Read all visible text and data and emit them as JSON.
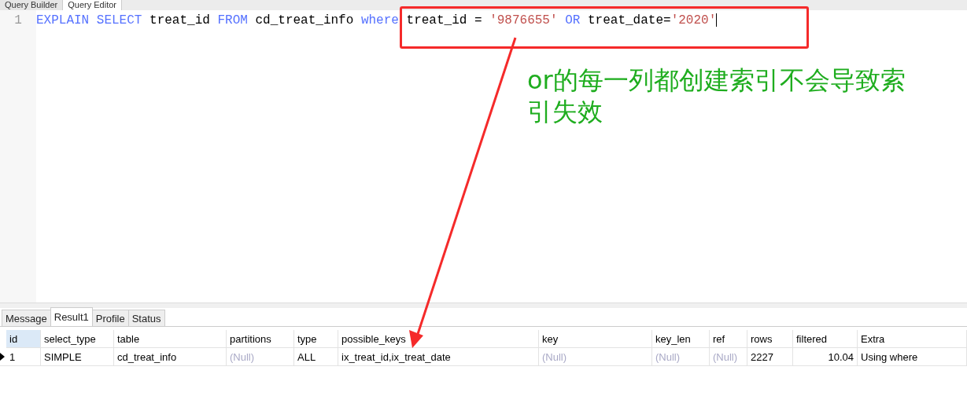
{
  "top_tabs": [
    {
      "label": "Query Builder",
      "selected": false
    },
    {
      "label": "Query Editor",
      "selected": true
    }
  ],
  "editor": {
    "line_number": "1",
    "tokens": [
      {
        "kind": "keyword",
        "text": "EXPLAIN SELECT"
      },
      {
        "kind": "plain",
        "text": "treat_id"
      },
      {
        "kind": "keyword",
        "text": "FROM"
      },
      {
        "kind": "plain",
        "text": "cd_treat_info"
      },
      {
        "kind": "keyword",
        "text": "where"
      },
      {
        "kind": "plain",
        "text": "treat_id ="
      },
      {
        "kind": "string",
        "text": "'9876655'"
      },
      {
        "kind": "keyword",
        "text": "OR"
      },
      {
        "kind": "plain",
        "text": "treat_date="
      },
      {
        "kind": "string",
        "text": "'2020'",
        "attached": true
      }
    ]
  },
  "annotation": {
    "text": "or的每一列都创建索引不会导致索引失效"
  },
  "result_tabs": [
    {
      "label": "Message",
      "selected": false
    },
    {
      "label": "Result1",
      "selected": true
    },
    {
      "label": "Profile",
      "selected": false
    },
    {
      "label": "Status",
      "selected": false
    }
  ],
  "table": {
    "columns": [
      {
        "label": "id",
        "selected": true
      },
      {
        "label": "select_type",
        "selected": false
      },
      {
        "label": "table",
        "selected": false
      },
      {
        "label": "partitions",
        "selected": false
      },
      {
        "label": "type",
        "selected": false
      },
      {
        "label": "possible_keys",
        "selected": false
      },
      {
        "label": "key",
        "selected": false
      },
      {
        "label": "key_len",
        "selected": false
      },
      {
        "label": "ref",
        "selected": false
      },
      {
        "label": "rows",
        "selected": false
      },
      {
        "label": "filtered",
        "selected": false
      },
      {
        "label": "Extra",
        "selected": false
      }
    ],
    "rows": [
      {
        "selected": true,
        "cells": [
          {
            "kind": "text",
            "text": "1"
          },
          {
            "kind": "text",
            "text": "SIMPLE"
          },
          {
            "kind": "text",
            "text": "cd_treat_info"
          },
          {
            "kind": "null",
            "text": "(Null)"
          },
          {
            "kind": "text",
            "text": "ALL"
          },
          {
            "kind": "text",
            "text": "ix_treat_id,ix_treat_date"
          },
          {
            "kind": "null",
            "text": "(Null)"
          },
          {
            "kind": "null",
            "text": "(Null)"
          },
          {
            "kind": "null",
            "text": "(Null)"
          },
          {
            "kind": "text",
            "text": "2227"
          },
          {
            "kind": "number",
            "text": "10.04"
          },
          {
            "kind": "text",
            "text": "Using where"
          }
        ]
      }
    ]
  }
}
